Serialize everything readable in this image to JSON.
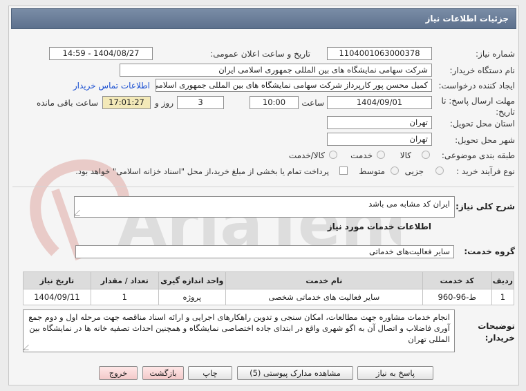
{
  "header": {
    "title": "جزئیات اطلاعات نیاز"
  },
  "form": {
    "need_number_label": "شماره نیاز:",
    "need_number": "1104001063000378",
    "announce_label": "تاریخ و ساعت اعلان عمومی:",
    "announce_value": "1404/08/27 - 14:59",
    "buyer_org_label": "نام دستگاه خریدار:",
    "buyer_org": "شرکت سهامی نمایشگاه های بین المللی جمهوری اسلامی ایران",
    "requester_label": "ایجاد کننده درخواست:",
    "requester": "کمیل محسن پور کارپرداز شرکت سهامی نمایشگاه های بین المللی جمهوری اسلامی ایران",
    "contact_link": "اطلاعات تماس خریدار",
    "deadline_label": "مهلت ارسال پاسخ: تا تاریخ:",
    "deadline_date": "1404/09/01",
    "time_label": "ساعت",
    "deadline_time": "10:00",
    "days_value": "3",
    "days_label": "روز و",
    "remaining_time": "17:01:27",
    "remaining_label": "ساعت باقی مانده",
    "province_label": "استان محل تحویل:",
    "province": "تهران",
    "city_label": "شهر محل تحویل:",
    "city": "تهران",
    "category_label": "طبقه بندی موضوعی:",
    "category_options": [
      "کالا",
      "خدمت",
      "کالا/خدمت"
    ],
    "process_label": "نوع فرآیند خرید :",
    "process_options": [
      "جزیی",
      "متوسط"
    ],
    "payment_note": "پرداخت تمام یا بخشی از مبلغ خرید،از محل \"اسناد خزانه اسلامی\" خواهد بود."
  },
  "summary": {
    "label": "شرح کلی نیاز:",
    "value": "ایران کد مشابه می باشد"
  },
  "services": {
    "section_title": "اطلاعات خدمات مورد نیاز",
    "group_label": "گروه خدمت:",
    "group_value": "سایر فعالیت‌های خدماتی",
    "columns": [
      "ردیف",
      "کد خدمت",
      "نام خدمت",
      "واحد اندازه گیری",
      "تعداد / مقدار",
      "تاریخ نیاز"
    ],
    "rows": [
      [
        "1",
        "ط-96-960",
        "سایر فعالیت های خدماتی شخصی",
        "پروژه",
        "1",
        "1404/09/11"
      ]
    ]
  },
  "notes": {
    "label": "توضیحات خریدار:",
    "value": "انجام خدمات مشاوره جهت مطالعات، امکان سنجی و تدوین راهکارهای اجرایی و ارائه اسناد مناقصه جهت مرحله اول و دوم جمع آوری فاضلاب و اتصال آن به اگو شهری واقع در ابتدای جاده اختصاصی نمایشگاه و همچنین احداث تصفیه خانه ها در نمایشگاه بین المللی تهران"
  },
  "buttons": {
    "respond": "پاسخ به نیاز",
    "view_docs": "مشاهده مدارک پیوستی (5)",
    "print": "چاپ",
    "back": "بازگشت",
    "exit": "خروج"
  },
  "watermark": {
    "text": "AriaTender.neT"
  },
  "colors": {
    "title_bar": "#5d718d",
    "link": "#1a4fd1",
    "highlight": "#f3e9b8",
    "watermark": "#c0392b"
  }
}
